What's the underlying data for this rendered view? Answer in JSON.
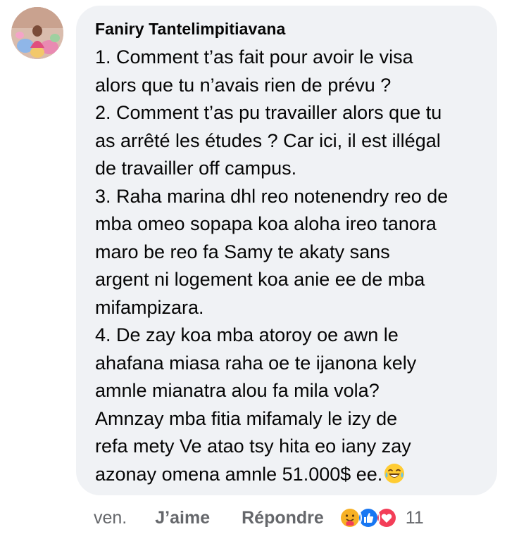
{
  "comment": {
    "author": "Faniry Tantelimpitiavana",
    "text": "1. Comment t’as fait pour avoir le visa\nalors que tu n’avais rien de prévu ?\n2. Comment t’as pu travailler alors que tu\nas arrêté les études ? Car ici, il est illégal\nde travailler off campus.\n3. Raha marina dhl reo notenendry reo de\nmba omeo sopapa koa aloha ireo tanora\nmaro be reo fa Samy te akaty sans\nargent ni logement koa anie ee de mba\nmifampizara.\n4. De zay koa mba atoroy oe awn le\nahafana miasa raha oe te ijanona kely\namnle mianatra alou fa mila vola?\nAmnzay mba fitia mifamaly le izy de\nrefa mety Ve atao tsy hita eo iany zay\nazonay omena amnle 51.000$ ee.",
    "trailing_emoji": "laughing-tears-emoji"
  },
  "actions": {
    "time": "ven.",
    "like_label": "J’aime",
    "reply_label": "Répondre",
    "reaction_count": "11",
    "reaction_icons": [
      "care-reaction-icon",
      "like-reaction-icon",
      "love-reaction-icon"
    ]
  },
  "colors": {
    "bubble_bg": "#f0f2f5",
    "text": "#050505",
    "secondary_text": "#65676b",
    "like_blue": "#1877f2",
    "love_red": "#f33e58",
    "care_yellow": "#f7b125"
  }
}
